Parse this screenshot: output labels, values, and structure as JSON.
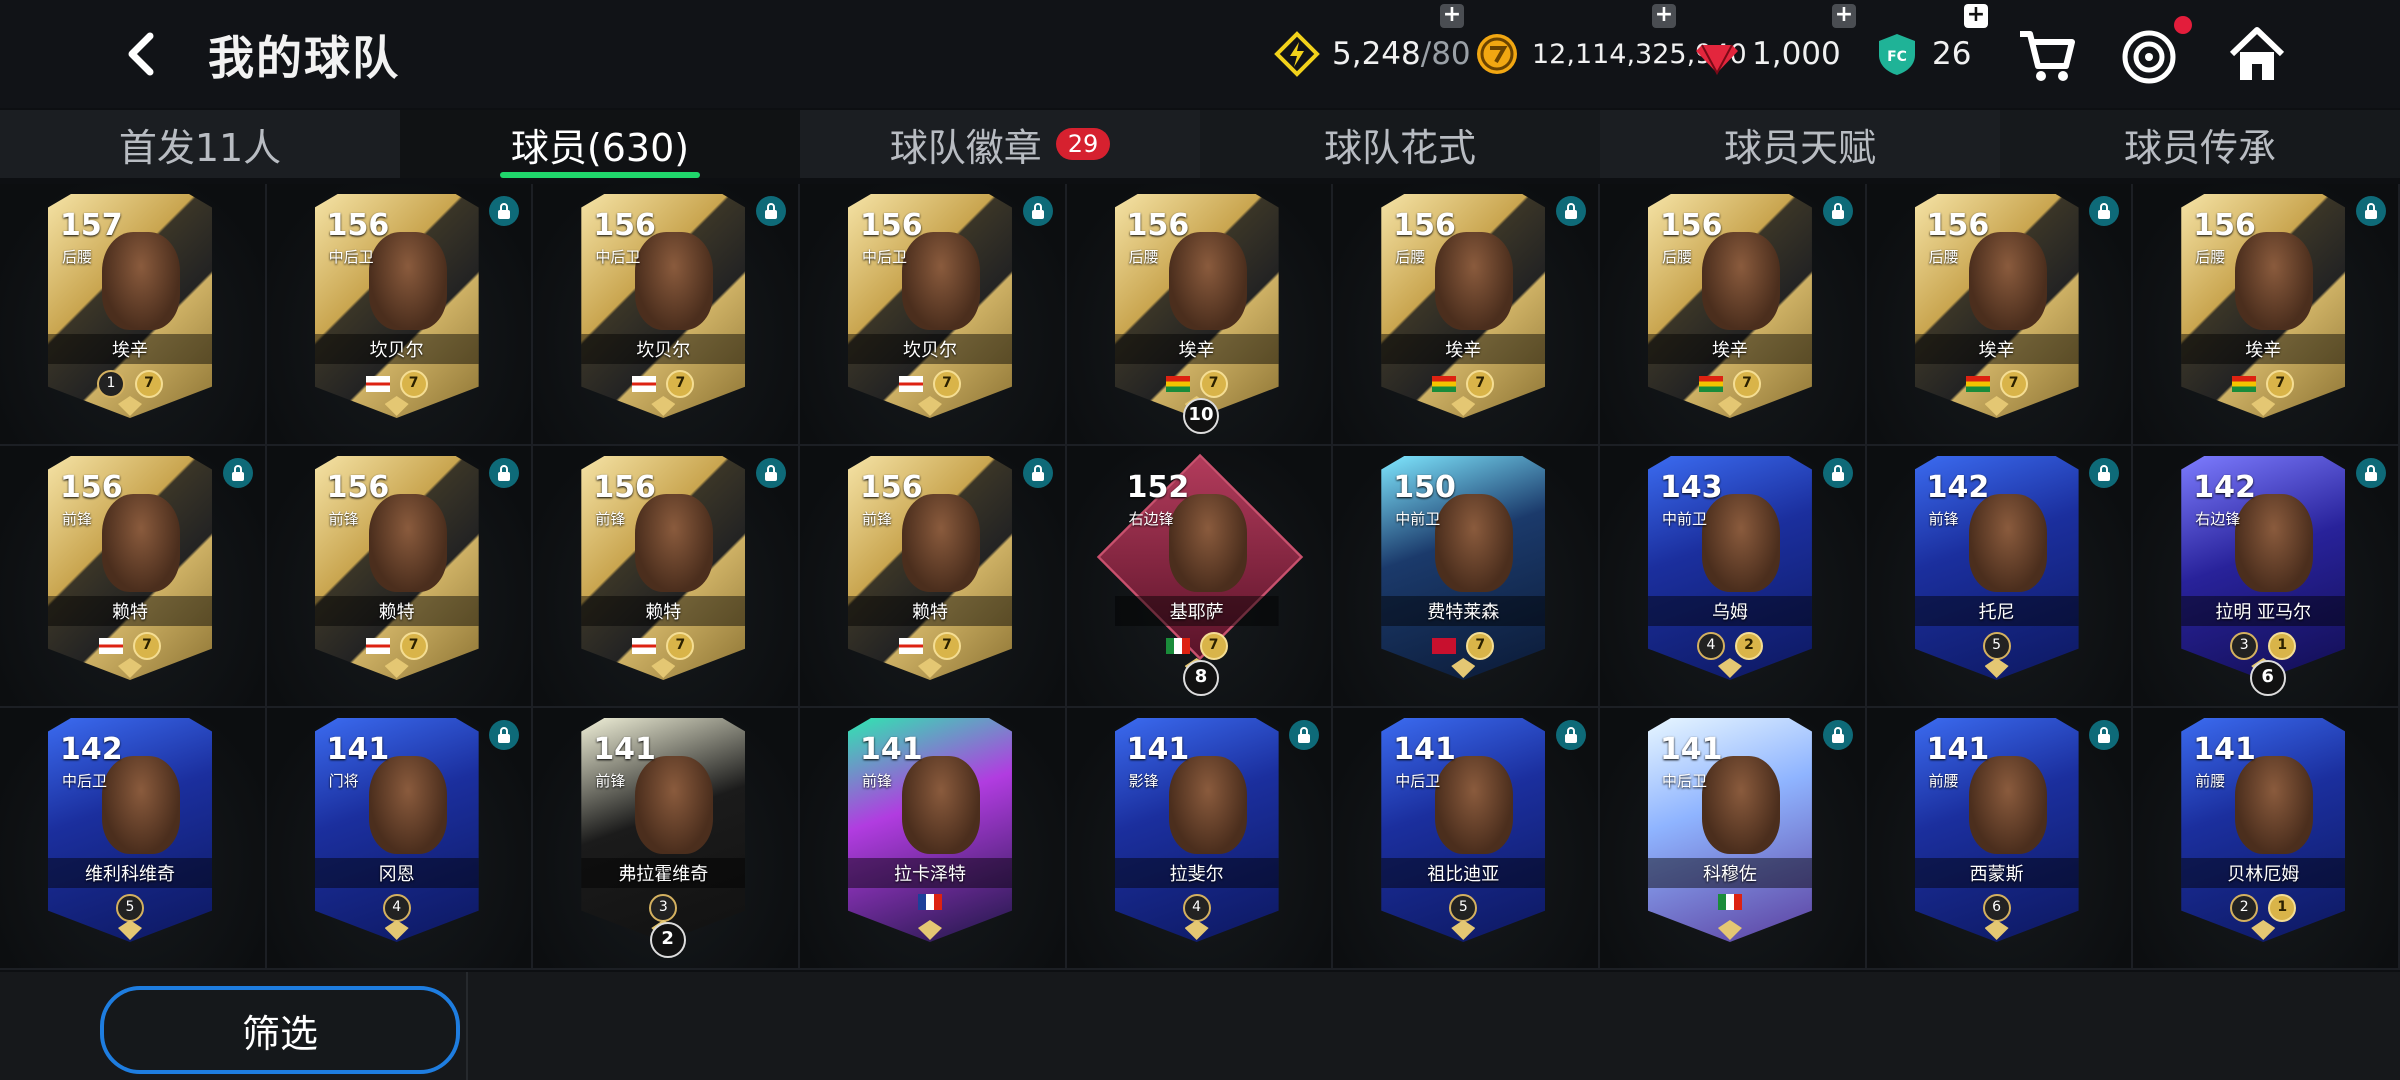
{
  "header": {
    "title": "我的球队",
    "back_icon": "chevron-left-icon",
    "currencies": [
      {
        "name": "energy",
        "icon": "lightning-icon",
        "value": "5,248",
        "max": "/80",
        "color": "#f2d21b"
      },
      {
        "name": "coins",
        "icon": "coin-icon",
        "value": "12,114,325,940",
        "color": "#f2a712"
      },
      {
        "name": "gems",
        "icon": "gem-icon",
        "value": "1,000",
        "color": "#e3263d"
      },
      {
        "name": "fc-points",
        "icon": "fc-shield-icon",
        "value": "26",
        "color": "#1fb397"
      }
    ],
    "actions": [
      "shopping-cart-icon",
      "target-icon",
      "home-icon"
    ]
  },
  "tabs": [
    {
      "label": "首发11人",
      "active": false
    },
    {
      "label": "球员(630)",
      "active": true
    },
    {
      "label": "球队徽章",
      "badge": "29",
      "active": false
    },
    {
      "label": "球队花式",
      "active": false
    },
    {
      "label": "球员天赋",
      "active": false
    },
    {
      "label": "球员传承",
      "active": false
    }
  ],
  "players": [
    {
      "ovr": "157",
      "pos": "后腰",
      "name": "埃辛",
      "style": "gold",
      "lvl": "1",
      "rank": "7",
      "locked": false
    },
    {
      "ovr": "156",
      "pos": "中后卫",
      "name": "坎贝尔",
      "style": "gold",
      "flag": "england",
      "rank": "7",
      "locked": true
    },
    {
      "ovr": "156",
      "pos": "中后卫",
      "name": "坎贝尔",
      "style": "gold",
      "flag": "england",
      "rank": "7",
      "locked": true
    },
    {
      "ovr": "156",
      "pos": "中后卫",
      "name": "坎贝尔",
      "style": "gold",
      "flag": "england",
      "rank": "7",
      "locked": true
    },
    {
      "ovr": "156",
      "pos": "后腰",
      "name": "埃辛",
      "style": "gold",
      "flag": "ghana",
      "rank": "7",
      "extra": "10",
      "locked": false
    },
    {
      "ovr": "156",
      "pos": "后腰",
      "name": "埃辛",
      "style": "gold",
      "flag": "ghana",
      "rank": "7",
      "locked": true
    },
    {
      "ovr": "156",
      "pos": "后腰",
      "name": "埃辛",
      "style": "gold",
      "flag": "ghana",
      "rank": "7",
      "locked": true
    },
    {
      "ovr": "156",
      "pos": "后腰",
      "name": "埃辛",
      "style": "gold",
      "flag": "ghana",
      "rank": "7",
      "locked": true
    },
    {
      "ovr": "156",
      "pos": "后腰",
      "name": "埃辛",
      "style": "gold",
      "flag": "ghana",
      "rank": "7",
      "locked": true
    },
    {
      "ovr": "156",
      "pos": "前锋",
      "name": "赖特",
      "style": "gold",
      "flag": "england",
      "rank": "7",
      "locked": true
    },
    {
      "ovr": "156",
      "pos": "前锋",
      "name": "赖特",
      "style": "gold",
      "flag": "england",
      "rank": "7",
      "locked": true
    },
    {
      "ovr": "156",
      "pos": "前锋",
      "name": "赖特",
      "style": "gold",
      "flag": "england",
      "rank": "7",
      "locked": true
    },
    {
      "ovr": "156",
      "pos": "前锋",
      "name": "赖特",
      "style": "gold",
      "flag": "england",
      "rank": "7",
      "locked": true
    },
    {
      "ovr": "152",
      "pos": "右边锋",
      "name": "基耶萨",
      "style": "maroon",
      "flag": "italy",
      "rank": "7",
      "extra": "8",
      "locked": false
    },
    {
      "ovr": "150",
      "pos": "中前卫",
      "name": "费特莱森",
      "style": "teal",
      "flag": "norway",
      "rank": "7",
      "locked": false
    },
    {
      "ovr": "143",
      "pos": "中前卫",
      "name": "乌姆",
      "style": "blue",
      "lvl": "4",
      "rank": "2",
      "locked": true
    },
    {
      "ovr": "142",
      "pos": "前锋",
      "name": "托尼",
      "style": "blue",
      "lvl": "5",
      "locked": true
    },
    {
      "ovr": "142",
      "pos": "右边锋",
      "name": "拉明 亚马尔",
      "style": "purple",
      "lvl": "3",
      "rank": "1",
      "extra": "6",
      "locked": true
    },
    {
      "ovr": "142",
      "pos": "中后卫",
      "name": "维利科维奇",
      "style": "blue",
      "lvl": "5",
      "locked": false
    },
    {
      "ovr": "141",
      "pos": "门将",
      "name": "冈恩",
      "style": "blue",
      "lvl": "4",
      "locked": true
    },
    {
      "ovr": "141",
      "pos": "前锋",
      "name": "弗拉霍维奇",
      "style": "silver",
      "lvl": "3",
      "extra": "2",
      "locked": false
    },
    {
      "ovr": "141",
      "pos": "前锋",
      "name": "拉卡泽特",
      "style": "pop",
      "flag": "france",
      "locked": false
    },
    {
      "ovr": "141",
      "pos": "影锋",
      "name": "拉斐尔",
      "style": "blue",
      "lvl": "4",
      "locked": true
    },
    {
      "ovr": "141",
      "pos": "中后卫",
      "name": "祖比迪亚",
      "style": "blue",
      "lvl": "5",
      "locked": true
    },
    {
      "ovr": "141",
      "pos": "中后卫",
      "name": "科穆佐",
      "style": "ice",
      "flag": "italy",
      "locked": true
    },
    {
      "ovr": "141",
      "pos": "前腰",
      "name": "西蒙斯",
      "style": "blue",
      "lvl": "6",
      "locked": true
    },
    {
      "ovr": "141",
      "pos": "前腰",
      "name": "贝林厄姆",
      "style": "blue",
      "lvl": "2",
      "rank": "1",
      "locked": false
    }
  ],
  "footer": {
    "filter_label": "筛选"
  }
}
